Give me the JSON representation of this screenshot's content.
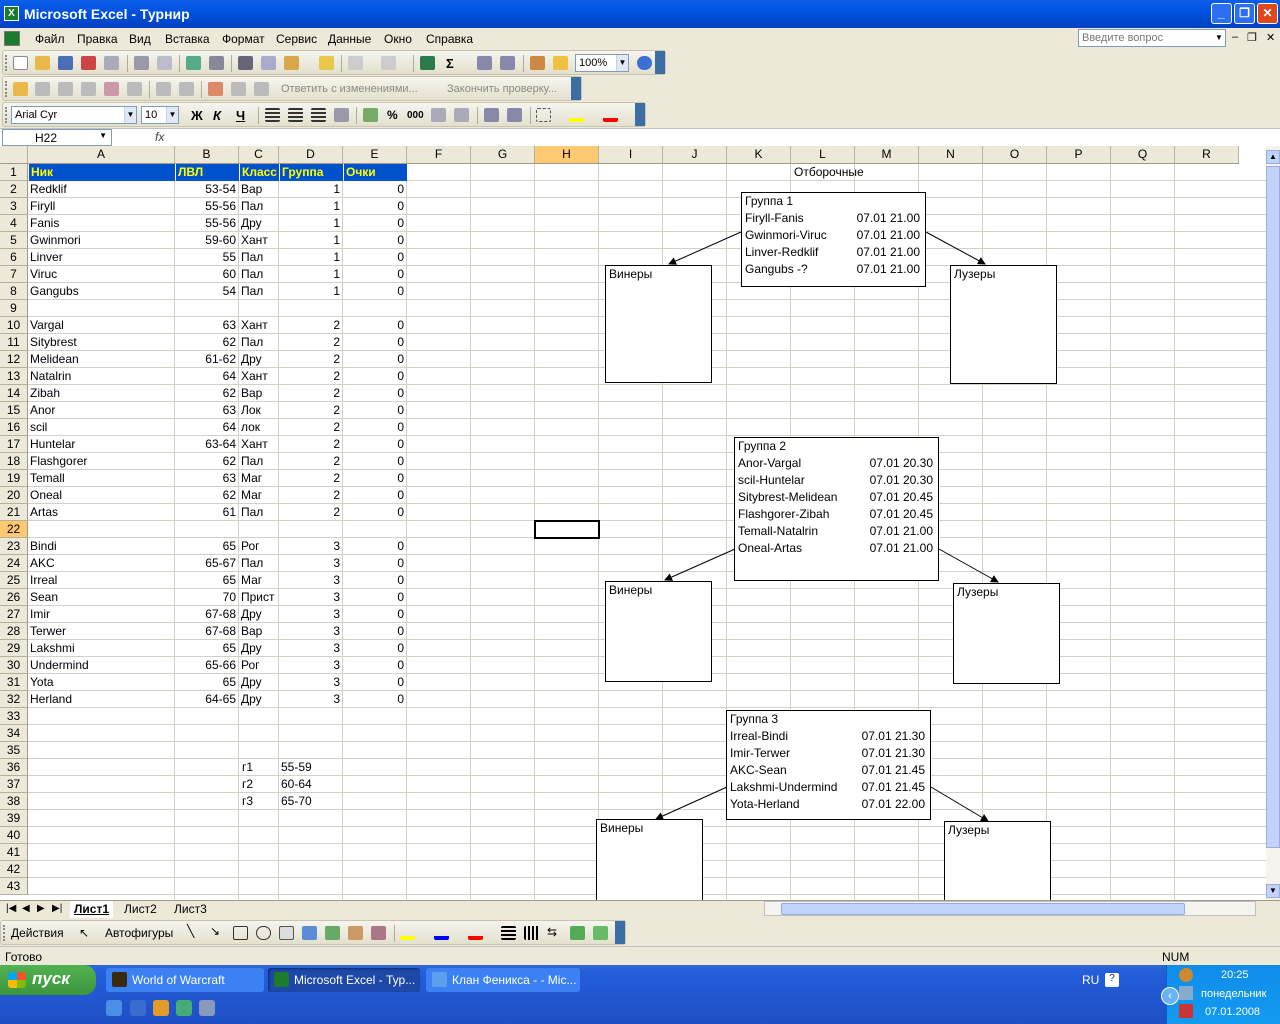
{
  "window": {
    "title": "Microsoft Excel - Турнир"
  },
  "menu": [
    "Файл",
    "Правка",
    "Вид",
    "Вставка",
    "Формат",
    "Сервис",
    "Данные",
    "Окно",
    "Справка"
  ],
  "ask_placeholder": "Введите вопрос",
  "toolbar": {
    "zoom": "100%",
    "font_name": "Arial Cyr",
    "font_size": "10",
    "reply_text": "Ответить с изменениями...",
    "finish_text": "Закончить проверку...",
    "bold": "Ж",
    "italic": "К",
    "underline": "Ч",
    "sum": "Σ",
    "percent": "%",
    "thousands": "000",
    "fx": "fx"
  },
  "formula": {
    "namebox": "H22",
    "content": ""
  },
  "columns": [
    "A",
    "B",
    "C",
    "D",
    "E",
    "F",
    "G",
    "H",
    "I",
    "J",
    "K",
    "L",
    "M",
    "N",
    "O",
    "P",
    "Q",
    "R"
  ],
  "rows": [
    "1",
    "2",
    "3",
    "4",
    "5",
    "6",
    "7",
    "8",
    "9",
    "10",
    "11",
    "12",
    "13",
    "14",
    "15",
    "16",
    "17",
    "18",
    "19",
    "20",
    "21",
    "22",
    "23",
    "24",
    "25",
    "26",
    "27",
    "28",
    "29",
    "30",
    "31",
    "32",
    "33",
    "34",
    "35",
    "36",
    "37",
    "38",
    "39",
    "40",
    "41",
    "42",
    "43"
  ],
  "header": {
    "nick": "Ник",
    "lvl": "ЛВЛ",
    "class": "Класс",
    "group": "Группа",
    "points": "Очки"
  },
  "players": [
    {
      "row": 2,
      "nick": "Redklif",
      "lvl": "53-54",
      "class": "Вар",
      "group": "1",
      "points": "0"
    },
    {
      "row": 3,
      "nick": "Firyll",
      "lvl": "55-56",
      "class": "Пал",
      "group": "1",
      "points": "0"
    },
    {
      "row": 4,
      "nick": "Fanis",
      "lvl": "55-56",
      "class": "Дру",
      "group": "1",
      "points": "0"
    },
    {
      "row": 5,
      "nick": "Gwinmori",
      "lvl": "59-60",
      "class": "Хант",
      "group": "1",
      "points": "0"
    },
    {
      "row": 6,
      "nick": "Linver",
      "lvl": "55",
      "class": "Пал",
      "group": "1",
      "points": "0"
    },
    {
      "row": 7,
      "nick": "Viruc",
      "lvl": "60",
      "class": "Пал",
      "group": "1",
      "points": "0"
    },
    {
      "row": 8,
      "nick": "Gangubs",
      "lvl": "54",
      "class": "Пал",
      "group": "1",
      "points": "0"
    },
    {
      "row": 10,
      "nick": "Vargal",
      "lvl": "63",
      "class": "Хант",
      "group": "2",
      "points": "0"
    },
    {
      "row": 11,
      "nick": "Sitybrest",
      "lvl": "62",
      "class": "Пал",
      "group": "2",
      "points": "0"
    },
    {
      "row": 12,
      "nick": "Melidean",
      "lvl": "61-62",
      "class": "Дру",
      "group": "2",
      "points": "0"
    },
    {
      "row": 13,
      "nick": "Natalrin",
      "lvl": "64",
      "class": "Хант",
      "group": "2",
      "points": "0"
    },
    {
      "row": 14,
      "nick": "Zibah",
      "lvl": "62",
      "class": "Вар",
      "group": "2",
      "points": "0"
    },
    {
      "row": 15,
      "nick": "Anor",
      "lvl": "63",
      "class": "Лок",
      "group": "2",
      "points": "0"
    },
    {
      "row": 16,
      "nick": "scil",
      "lvl": "64",
      "class": "лок",
      "group": "2",
      "points": "0"
    },
    {
      "row": 17,
      "nick": "Huntelar",
      "lvl": "63-64",
      "class": "Хант",
      "group": "2",
      "points": "0"
    },
    {
      "row": 18,
      "nick": "Flashgorer",
      "lvl": "62",
      "class": "Пал",
      "group": "2",
      "points": "0"
    },
    {
      "row": 19,
      "nick": "Temall",
      "lvl": "63",
      "class": "Маг",
      "group": "2",
      "points": "0"
    },
    {
      "row": 20,
      "nick": "Oneal",
      "lvl": "62",
      "class": "Маг",
      "group": "2",
      "points": "0"
    },
    {
      "row": 21,
      "nick": "Artas",
      "lvl": "61",
      "class": "Пал",
      "group": "2",
      "points": "0"
    },
    {
      "row": 23,
      "nick": "Bindi",
      "lvl": "65",
      "class": "Рог",
      "group": "3",
      "points": "0"
    },
    {
      "row": 24,
      "nick": "AKC",
      "lvl": "65-67",
      "class": "Пал",
      "group": "3",
      "points": "0"
    },
    {
      "row": 25,
      "nick": "Irreal",
      "lvl": "65",
      "class": "Маг",
      "group": "3",
      "points": "0"
    },
    {
      "row": 26,
      "nick": "Sean",
      "lvl": "70",
      "class": "Прист",
      "group": "3",
      "points": "0"
    },
    {
      "row": 27,
      "nick": "Imir",
      "lvl": "67-68",
      "class": "Дру",
      "group": "3",
      "points": "0"
    },
    {
      "row": 28,
      "nick": "Terwer",
      "lvl": "67-68",
      "class": "Вар",
      "group": "3",
      "points": "0"
    },
    {
      "row": 29,
      "nick": "Lakshmi",
      "lvl": "65",
      "class": "Дру",
      "group": "3",
      "points": "0"
    },
    {
      "row": 30,
      "nick": "Undermind",
      "lvl": "65-66",
      "class": "Рог",
      "group": "3",
      "points": "0"
    },
    {
      "row": 31,
      "nick": "Yota",
      "lvl": "65",
      "class": "Дру",
      "group": "3",
      "points": "0"
    },
    {
      "row": 32,
      "nick": "Herland",
      "lvl": "64-65",
      "class": "Дру",
      "group": "3",
      "points": "0"
    }
  ],
  "ranges": [
    {
      "row": 36,
      "name": "г1",
      "range": "55-59"
    },
    {
      "row": 37,
      "name": "г2",
      "range": "60-64"
    },
    {
      "row": 38,
      "name": "г3",
      "range": "65-70"
    }
  ],
  "section_title": "Отборочные",
  "groups": [
    {
      "title": "Группа 1",
      "matches": [
        {
          "pair": "Firyll-Fanis",
          "time": "07.01 21.00"
        },
        {
          "pair": "Gwinmori-Viruc",
          "time": "07.01 21.00"
        },
        {
          "pair": "Linver-Redklif",
          "time": "07.01 21.00"
        },
        {
          "pair": "Gangubs -?",
          "time": "07.01 21.00"
        }
      ],
      "winners": "Винеры",
      "losers": "Лузеры"
    },
    {
      "title": "Группа 2",
      "matches": [
        {
          "pair": "Anor-Vargal",
          "time": "07.01 20.30"
        },
        {
          "pair": "scil-Huntelar",
          "time": "07.01 20.30"
        },
        {
          "pair": "Sitybrest-Melidean",
          "time": "07.01 20.45"
        },
        {
          "pair": "Flashgorer-Zibah",
          "time": "07.01 20.45"
        },
        {
          "pair": "Temall-Natalrin",
          "time": "07.01 21.00"
        },
        {
          "pair": "Oneal-Artas",
          "time": "07.01 21.00"
        }
      ],
      "winners": "Винеры",
      "losers": "Лузеры"
    },
    {
      "title": "Группа 3",
      "matches": [
        {
          "pair": "Irreal-Bindi",
          "time": "07.01 21.30"
        },
        {
          "pair": "Imir-Terwer",
          "time": "07.01 21.30"
        },
        {
          "pair": "AKC-Sean",
          "time": "07.01 21.45"
        },
        {
          "pair": "Lakshmi-Undermind",
          "time": "07.01 21.45"
        },
        {
          "pair": "Yota-Herland",
          "time": "07.01 22.00"
        }
      ],
      "winners": "Винеры",
      "losers": "Лузеры"
    }
  ],
  "sheet_tabs": [
    "Лист1",
    "Лист2",
    "Лист3"
  ],
  "drawing": {
    "actions": "Действия",
    "autoshapes": "Автофигуры"
  },
  "status": {
    "ready": "Готово",
    "num": "NUM"
  },
  "taskbar": {
    "start": "пуск",
    "tasks": [
      "World of Warcraft",
      "Microsoft Excel - Тур...",
      "Клан Феникса - - Mic..."
    ],
    "lang": "RU",
    "time": "20:25",
    "day": "понедельник",
    "date": "07.01.2008"
  }
}
